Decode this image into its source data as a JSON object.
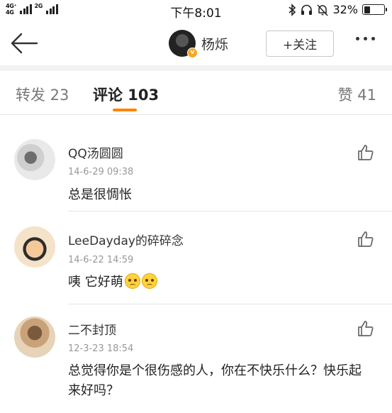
{
  "status_bar": {
    "network_1": "4G⁺",
    "network_1b": "4G",
    "network_2": "2G",
    "time": "下午8:01",
    "battery": "32%",
    "battery_level": 0.32
  },
  "nav": {
    "user_name": "杨烁",
    "follow_label": "+关注"
  },
  "tabs": {
    "repost": "转发 23",
    "comment": "评论 103",
    "like": "赞 41"
  },
  "comments": [
    {
      "name": "QQ汤圆圆",
      "time": "14-6-29 09:38",
      "text": "总是很惆怅"
    },
    {
      "name": "LeeDayday的碎碎念",
      "time": "14-6-22 14:59",
      "text": "咦 它好萌"
    },
    {
      "name": "二不封顶",
      "time": "12-3-23 18:54",
      "text": "总觉得你是个很伤感的人，你在不快乐什么？快乐起来好吗？"
    }
  ]
}
